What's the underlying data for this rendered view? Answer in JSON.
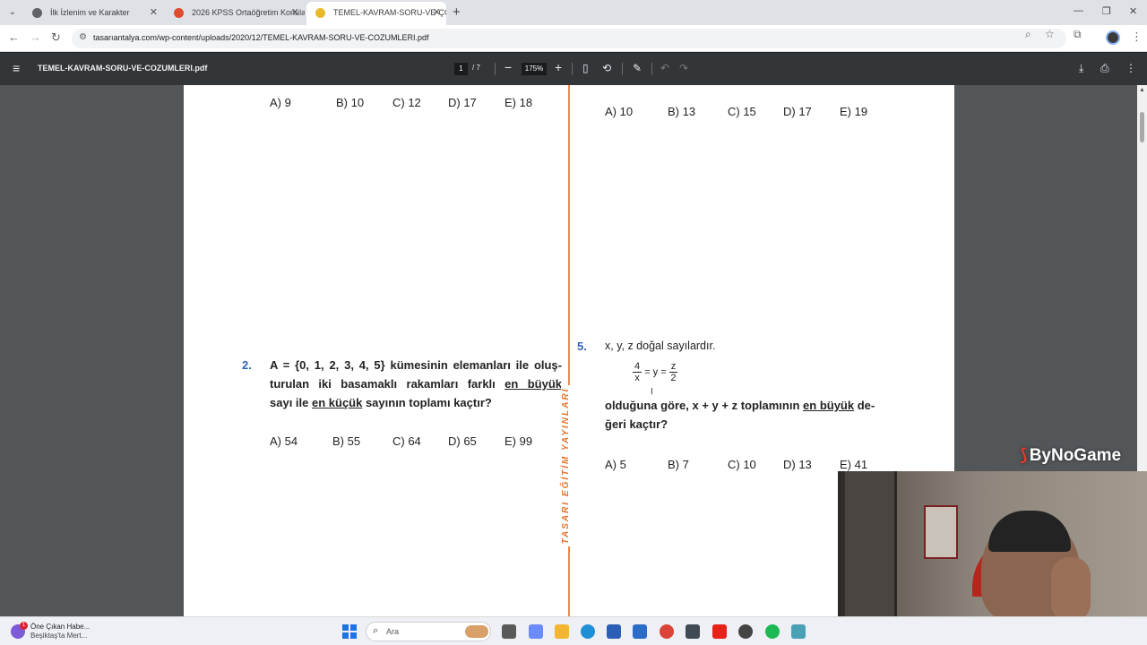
{
  "browser": {
    "tabs": [
      {
        "title": "İlk İzlenim ve Karakter",
        "favicon_color": "#5f6368",
        "active": false
      },
      {
        "title": "2026 KPSS Ortaöğretim Konula",
        "favicon_color": "#e04a2f",
        "active": false
      },
      {
        "title": "TEMEL-KAVRAM-SORU-VE-ÇÖZ",
        "favicon_color": "#e8b92c",
        "active": true
      }
    ],
    "new_tab_label": "+",
    "url": "tasarıantalya.com/wp-content/uploads/2020/12/TEMEL-KAVRAM-SORU-VE-COZUMLERI.pdf"
  },
  "pdf_toolbar": {
    "file_name": "TEMEL-KAVRAM-SORU-VE-COZUMLERI.pdf",
    "current_page": "1",
    "total_pages": "/ 7",
    "zoom": "175%"
  },
  "page": {
    "left": {
      "q1_options": [
        "A) 9",
        "B) 10",
        "C) 12",
        "D) 17",
        "E) 18"
      ],
      "q2": {
        "number": "2.",
        "line1": "A = {0, 1, 2, 3, 4, 5} kümesinin elemanları ile oluş-",
        "line2_pre": "turulan iki basamaklı rakamları farklı ",
        "line2_ul": "en büyük",
        "line3_pre": "sayı ile ",
        "line3_ul": "en küçük",
        "line3_post": " sayının toplamı kaçtır?",
        "options": [
          "A)  54",
          "B) 55",
          "C) 64",
          "D) 65",
          "E) 99"
        ]
      }
    },
    "right": {
      "q4_options": [
        "A)  10",
        "B) 13",
        "C) 15",
        "D) 17",
        "E)  19"
      ],
      "q5": {
        "number": "5.",
        "intro": "x, y, z doğal sayılardır.",
        "frac1_num": "4",
        "frac1_den": "x",
        "mid": "= y =",
        "frac2_num": "z",
        "frac2_den": "2",
        "line1_pre": "olduğuna göre, x + y + z toplamının ",
        "line1_ul": "en büyük",
        "line1_post": " de-",
        "line2": "ğeri kaçtır?",
        "options": [
          "A)  5",
          "B) 7",
          "C) 10",
          "D) 13",
          "E) 41"
        ]
      }
    },
    "side_brand": "TASARI EĞİTİM YAYINLARI"
  },
  "overlay": {
    "watermark": "ByNoGame"
  },
  "taskbar": {
    "news_line1": "Öne Çıkan Habe...",
    "news_line2": "Beşiktaş'ta Mert...",
    "news_badge": "1",
    "search_placeholder": "Ara",
    "apps": [
      {
        "name": "files-app",
        "color": "#5a5a5a"
      },
      {
        "name": "copilot-app",
        "color": "#6a8cff"
      },
      {
        "name": "explorer-app",
        "color": "#f2b632"
      },
      {
        "name": "edge-app",
        "color": "#1f8fd6"
      },
      {
        "name": "store-app",
        "color": "#2a5fb5"
      },
      {
        "name": "snipping-app",
        "color": "#2c6cc9"
      },
      {
        "name": "chrome-app",
        "color": "#db4437"
      },
      {
        "name": "tool-app",
        "color": "#404a55"
      },
      {
        "name": "youtube-app",
        "color": "#e62117"
      },
      {
        "name": "obs-app",
        "color": "#444444"
      },
      {
        "name": "spotify-app",
        "color": "#1db954"
      },
      {
        "name": "other-app",
        "color": "#4aa0b5"
      }
    ]
  },
  "colors": {
    "accent_orange": "#f08a42",
    "question_number_blue": "#2f63b6",
    "pdf_toolbar": "#323639"
  }
}
